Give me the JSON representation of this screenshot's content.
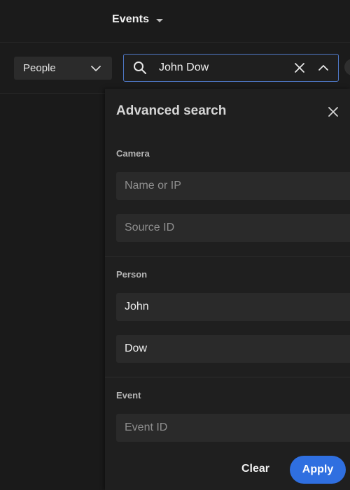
{
  "header": {
    "events_label": "Events",
    "events_icon": "caret-down-icon"
  },
  "filters": {
    "category": {
      "selected": "People",
      "icon": "chevron-down-icon"
    },
    "search": {
      "value": "John Dow",
      "icons": [
        "search-icon",
        "close-icon",
        "chevron-up-icon"
      ],
      "border_color": "#4f79c8"
    }
  },
  "advanced_search": {
    "title": "Advanced search",
    "close_icon": "close-icon",
    "sections": {
      "camera": {
        "label": "Camera",
        "fields": [
          {
            "placeholder": "Name or IP",
            "value": ""
          },
          {
            "placeholder": "Source ID",
            "value": ""
          }
        ]
      },
      "person": {
        "label": "Person",
        "fields": [
          {
            "placeholder": "",
            "value": "John"
          },
          {
            "placeholder": "",
            "value": "Dow"
          }
        ]
      },
      "event": {
        "label": "Event",
        "fields": [
          {
            "placeholder": "Event ID",
            "value": ""
          }
        ]
      }
    },
    "actions": {
      "clear_label": "Clear",
      "apply_label": "Apply",
      "apply_color": "#2f6fe0"
    }
  }
}
